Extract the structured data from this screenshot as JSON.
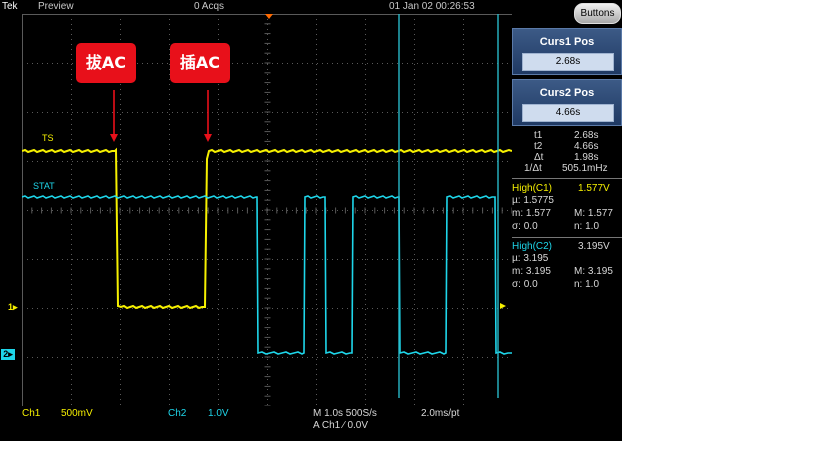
{
  "topbar": {
    "brand": "Tek",
    "mode": "Preview",
    "acqs": "0 Acqs",
    "datetime": "01 Jan 02 00:26:53",
    "buttons_label": "Buttons"
  },
  "annotations": {
    "unplug": "拔AC",
    "plug": "插AC",
    "ts_label": "TS",
    "stat_label": "STAT"
  },
  "markers": {
    "ch1": "1",
    "ch2": "2"
  },
  "cursors": {
    "curs1": {
      "title": "Curs1 Pos",
      "value": "2.68s"
    },
    "curs2": {
      "title": "Curs2 Pos",
      "value": "4.66s"
    },
    "readout": [
      {
        "k": "t1",
        "v": "2.68s"
      },
      {
        "k": "t2",
        "v": "4.66s"
      },
      {
        "k": "Δt",
        "v": "1.98s"
      },
      {
        "k": "1/Δt",
        "v": "505.1mHz"
      }
    ]
  },
  "measurements": {
    "c1": {
      "title": "High(C1)",
      "title_val": "1.577V",
      "mu": "µ: 1.5775",
      "m": "m: 1.577",
      "M": "M: 1.577",
      "sigma": "σ: 0.0",
      "n": "n: 1.0"
    },
    "c2": {
      "title": "High(C2)",
      "title_val": "3.195V",
      "mu": "µ: 3.195",
      "m": "m: 3.195",
      "M": "M: 3.195",
      "sigma": "σ: 0.0",
      "n": "n: 1.0"
    }
  },
  "bottombar": {
    "ch1_name": "Ch1",
    "ch1_scale": "500mV",
    "ch2_name": "Ch2",
    "ch2_scale": "1.0V",
    "timebase": "M 1.0s 500S/s",
    "resolution": "2.0ms/pt",
    "trigger": "A  Ch1  ∕  0.0V"
  },
  "colors": {
    "ch1": "#f6f000",
    "ch2": "#1ed6ea",
    "callout": "#e8101a",
    "cursor": "#29b8c8"
  }
}
